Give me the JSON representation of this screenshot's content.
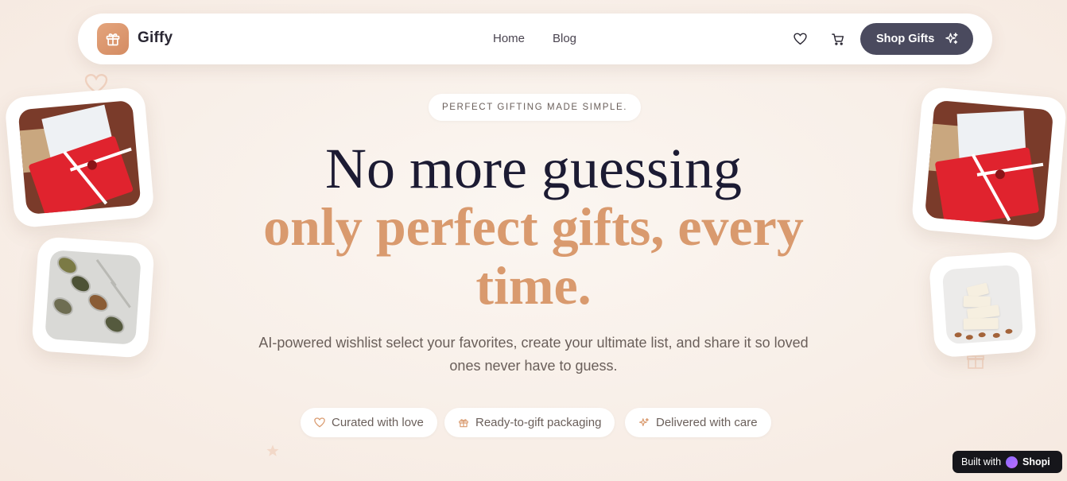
{
  "nav": {
    "brand": "Giffy",
    "links": [
      "Home",
      "Blog"
    ],
    "icons": [
      "heart-icon",
      "cart-icon"
    ],
    "cta_label": "Shop Gifts"
  },
  "hero": {
    "tagline": "PERFECT GIFTING MADE SIMPLE.",
    "headline_line1": "No more guessing",
    "headline_line2": "only perfect gifts, every time.",
    "subtitle": "AI-powered wishlist select your favorites, create your ultimate list, and share it so loved ones never have to guess.",
    "features": [
      {
        "icon": "heart-icon",
        "label": "Curated with love"
      },
      {
        "icon": "gift-icon",
        "label": "Ready-to-gift packaging"
      },
      {
        "icon": "sparkles-icon",
        "label": "Delivered with care"
      }
    ]
  },
  "badge": {
    "prefix": "Built with",
    "brand": "Shopi"
  },
  "colors": {
    "accent": "#d99a6e",
    "headline": "#1c1b33",
    "cta_bg": "#4a4a5e",
    "page_bg": "#f8efe8"
  }
}
